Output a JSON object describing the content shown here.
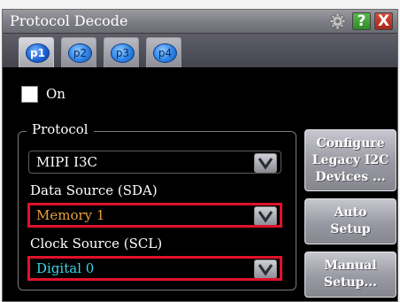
{
  "window": {
    "title": "Protocol Decode"
  },
  "titlebar": {
    "gear_icon": "gear-icon",
    "help_label": "?",
    "close_label": "X"
  },
  "tabs": [
    {
      "label": "p1",
      "active": true
    },
    {
      "label": "p2",
      "active": false
    },
    {
      "label": "p3",
      "active": false
    },
    {
      "label": "p4",
      "active": false
    }
  ],
  "on_checkbox": {
    "label": "On",
    "checked": false
  },
  "protocol_group": {
    "title": "Protocol",
    "protocol": {
      "value": "MIPI I3C"
    },
    "data_source": {
      "label": "Data Source (SDA)",
      "value": "Memory 1",
      "color": "#e8a03c"
    },
    "clock_source": {
      "label": "Clock Source (SCL)",
      "value": "Digital 0",
      "color": "#37d6e6"
    }
  },
  "side_buttons": {
    "configure": {
      "line1": "Configure",
      "line2": "Legacy I2C",
      "line3": "Devices ..."
    },
    "auto_setup": {
      "line1": "Auto",
      "line2": "Setup"
    },
    "manual_setup": {
      "line1": "Manual",
      "line2": "Setup..."
    }
  },
  "colors": {
    "highlight": "#e0122a",
    "protocol_text": "#ffffff"
  }
}
